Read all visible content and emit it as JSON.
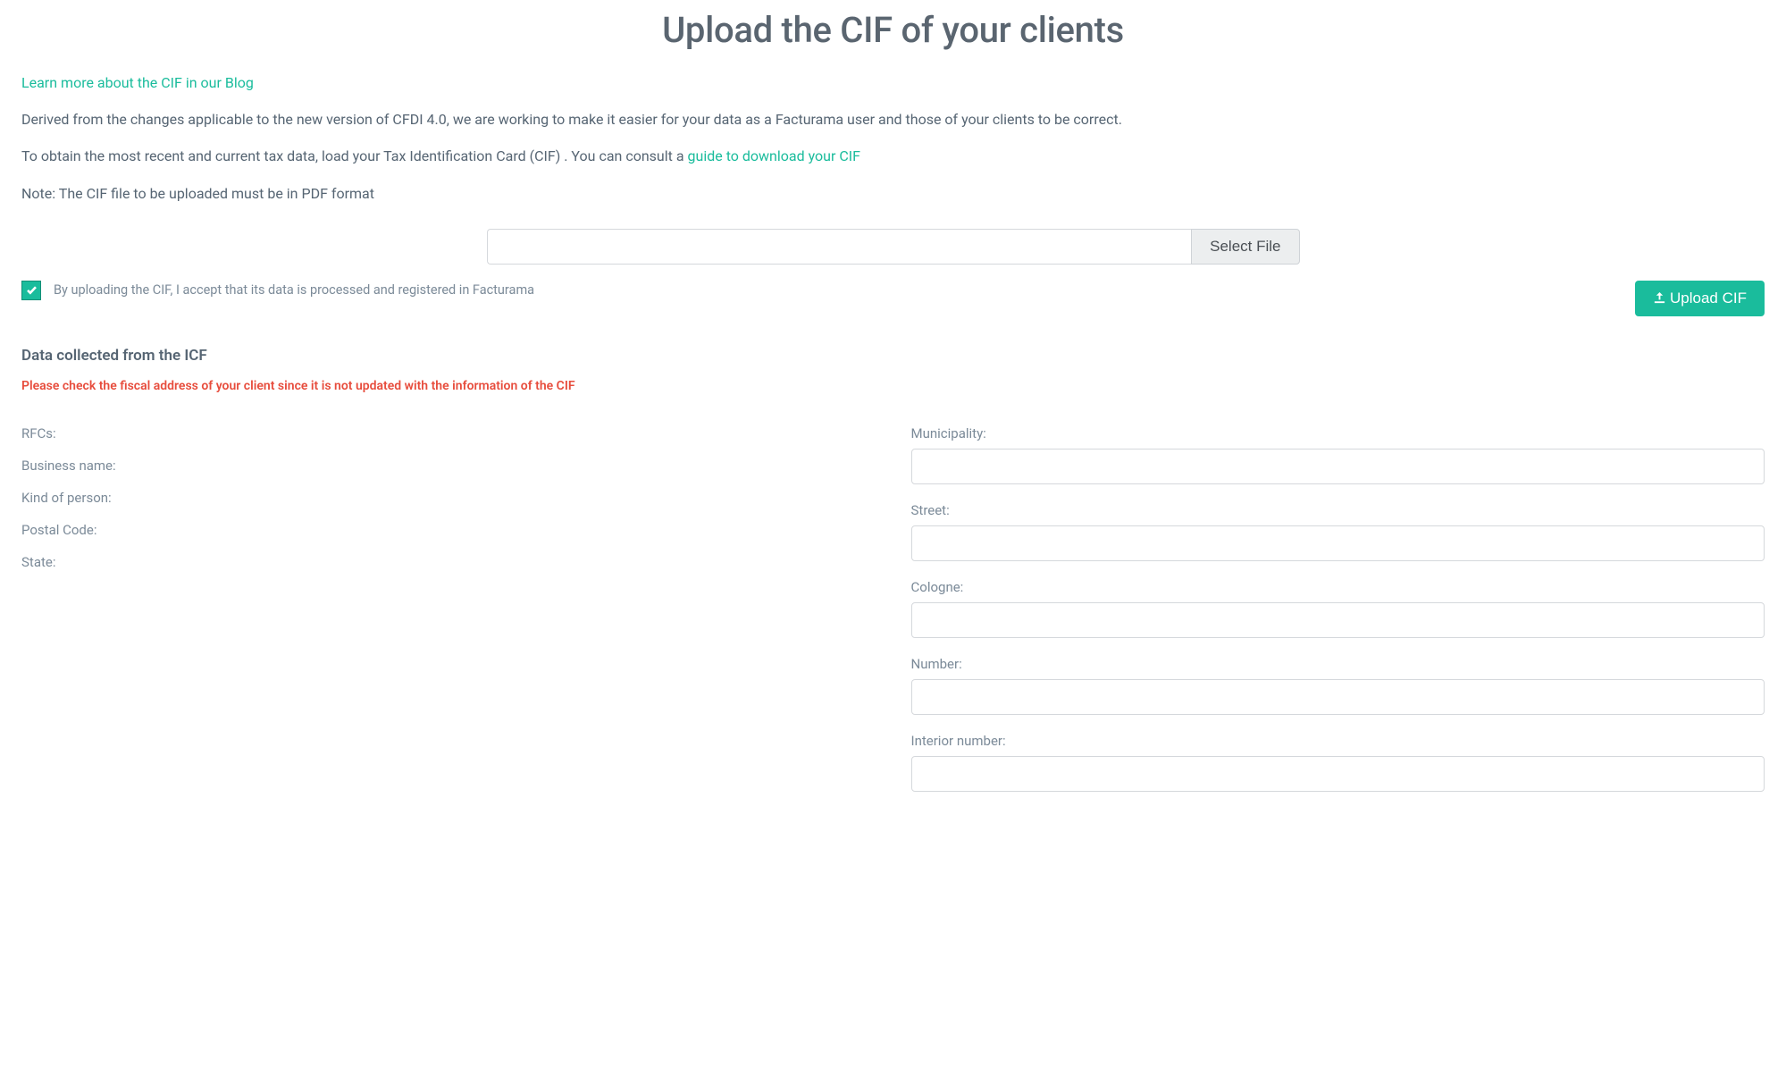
{
  "title": "Upload the CIF of your clients",
  "intro": {
    "blog_link": "Learn more about the CIF in our Blog",
    "p1": "Derived from the changes applicable to the new version of CFDI 4.0, we are working to make it easier for your data as a Facturama user and those of your clients to be correct.",
    "p2_prefix": "To obtain the most recent and current tax data, load your Tax Identification Card (CIF) . You can consult a ",
    "p2_link": "guide to download your CIF",
    "note": "Note: The CIF file to be uploaded must be in PDF format"
  },
  "file": {
    "value": "",
    "select_label": "Select File"
  },
  "accept": {
    "checked": true,
    "text": "By uploading the CIF, I accept that its data is processed and registered in Facturama"
  },
  "upload_label": "Upload CIF",
  "section_title": "Data collected from the ICF",
  "warning": "Please check the fiscal address of your client since it is not updated with the information of the CIF",
  "readonly_fields": {
    "rfc_label": "RFCs:",
    "business_label": "Business name:",
    "person_label": "Kind of person:",
    "postal_label": "Postal Code:",
    "state_label": "State:"
  },
  "address_fields": {
    "municipality_label": "Municipality:",
    "municipality_value": "",
    "street_label": "Street:",
    "street_value": "",
    "cologne_label": "Cologne:",
    "cologne_value": "",
    "number_label": "Number:",
    "number_value": "",
    "interior_label": "Interior number:",
    "interior_value": ""
  }
}
